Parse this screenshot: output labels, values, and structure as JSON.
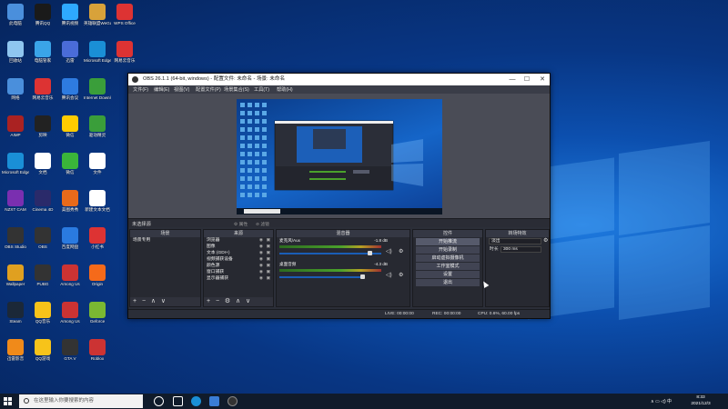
{
  "desktop_icons": [
    {
      "label": "此电脑",
      "color": "#4a8fdc"
    },
    {
      "label": "腾讯QQ",
      "color": "#1a1a1a"
    },
    {
      "label": "腾讯视频",
      "color": "#2ea9ff"
    },
    {
      "label": "英雄联盟WeGame",
      "color": "#d8a23a"
    },
    {
      "label": "WPS Office",
      "color": "#d33"
    },
    {
      "label": "回收站",
      "color": "#8fc6ef"
    },
    {
      "label": "电脑管家",
      "color": "#3aa4e8"
    },
    {
      "label": "迅雷",
      "color": "#4a6cd8"
    },
    {
      "label": "Microsoft Edge",
      "color": "#1a8fd6"
    },
    {
      "label": "网易云音乐",
      "color": "#d33"
    },
    {
      "label": "网络",
      "color": "#4a8fdc"
    },
    {
      "label": "网易云音乐",
      "color": "#d33"
    },
    {
      "label": "腾讯会议",
      "color": "#2e7be0"
    },
    {
      "label": "Internet Download",
      "color": "#3a9e3a"
    },
    {
      "label": "AIMP",
      "color": "#aa2222"
    },
    {
      "label": "剪映",
      "color": "#222"
    },
    {
      "label": "微信",
      "color": "#ffcc00"
    },
    {
      "label": "驱动精灵",
      "color": "#3a9e3a"
    },
    {
      "label": "Microsoft Edge",
      "color": "#1a8fd6"
    },
    {
      "label": "文档",
      "color": "#ffffff"
    },
    {
      "label": "微信",
      "color": "#3ab53a"
    },
    {
      "label": "文件",
      "color": "#ffffff"
    },
    {
      "label": "NZXT CAM",
      "color": "#7a2fb0"
    },
    {
      "label": "Cinema 4D",
      "color": "#2a2a6a"
    },
    {
      "label": "美图秀秀",
      "color": "#e86a1a"
    },
    {
      "label": "新建文本文档",
      "color": "#ffffff"
    },
    {
      "label": "OBS Studio",
      "color": "#333"
    },
    {
      "label": "OBS",
      "color": "#333"
    },
    {
      "label": "百度网盘",
      "color": "#2a7ae0"
    },
    {
      "label": "小红书",
      "color": "#d33"
    },
    {
      "label": "Wallpaper",
      "color": "#e0a020"
    },
    {
      "label": "PUBG",
      "color": "#333"
    },
    {
      "label": "Among Us",
      "color": "#c33"
    },
    {
      "label": "Origin",
      "color": "#f56a1a"
    },
    {
      "label": "Steam",
      "color": "#1b2838"
    },
    {
      "label": "QQ音乐",
      "color": "#f7c31a"
    },
    {
      "label": "Among Us",
      "color": "#c33"
    },
    {
      "label": "Geforce",
      "color": "#7ab832"
    },
    {
      "label": "迅雷影音",
      "color": "#f08a1a"
    },
    {
      "label": "QQ游戏",
      "color": "#f7c31a"
    },
    {
      "label": "GTA V",
      "color": "#333"
    },
    {
      "label": "Roblox",
      "color": "#cc3333"
    }
  ],
  "obs": {
    "title": "OBS 26.1.1 (64-bit, windows) - 配置文件: 未命名 - 场景: 未命名",
    "controls": [
      "—",
      "☐",
      "✕"
    ],
    "menu": [
      "文件(F)",
      "编辑(E)",
      "视图(V)",
      "配置文件(P)",
      "场景集合(S)",
      "工具(T)",
      "帮助(H)"
    ],
    "scene_label": "未选择源",
    "scene_buttons": [
      "属性",
      "滤镜"
    ],
    "docks": {
      "scenes": {
        "title": "场景",
        "items": [
          "场景专用"
        ]
      },
      "sources": {
        "title": "来源",
        "items": [
          "浏览器",
          "图像",
          "文本 (GDI+)",
          "视频捕获设备",
          "颜色源",
          "窗口捕获",
          "显示器捕获"
        ]
      },
      "mixer": {
        "title": "混音器",
        "channels": [
          {
            "name": "麦克风/Aux",
            "db": "-1.8 dB"
          },
          {
            "name": "桌面音频",
            "db": "-4.3 dB"
          }
        ]
      },
      "controls": {
        "title": "控件",
        "buttons": [
          "开始推流",
          "开始录制",
          "启动虚拟摄像机",
          "工作室模式",
          "设置",
          "退出"
        ]
      },
      "transitions": {
        "title": "转场特效",
        "type_value": "淡出",
        "duration_label": "时长",
        "duration_value": "300 ms"
      }
    },
    "foot_buttons": [
      "+",
      "−",
      "∧",
      "∨"
    ],
    "status": {
      "live": "LIVE: 00:00:00",
      "rec": "REC: 00:00:00",
      "cpu": "CPU: 0.6%, 60.00 fps"
    }
  },
  "taskbar": {
    "search_placeholder": "在这里输入你要搜索的内容",
    "time": "8:33",
    "date": "2021/12/3",
    "tray": "∧  ▭  ◁)  中"
  }
}
